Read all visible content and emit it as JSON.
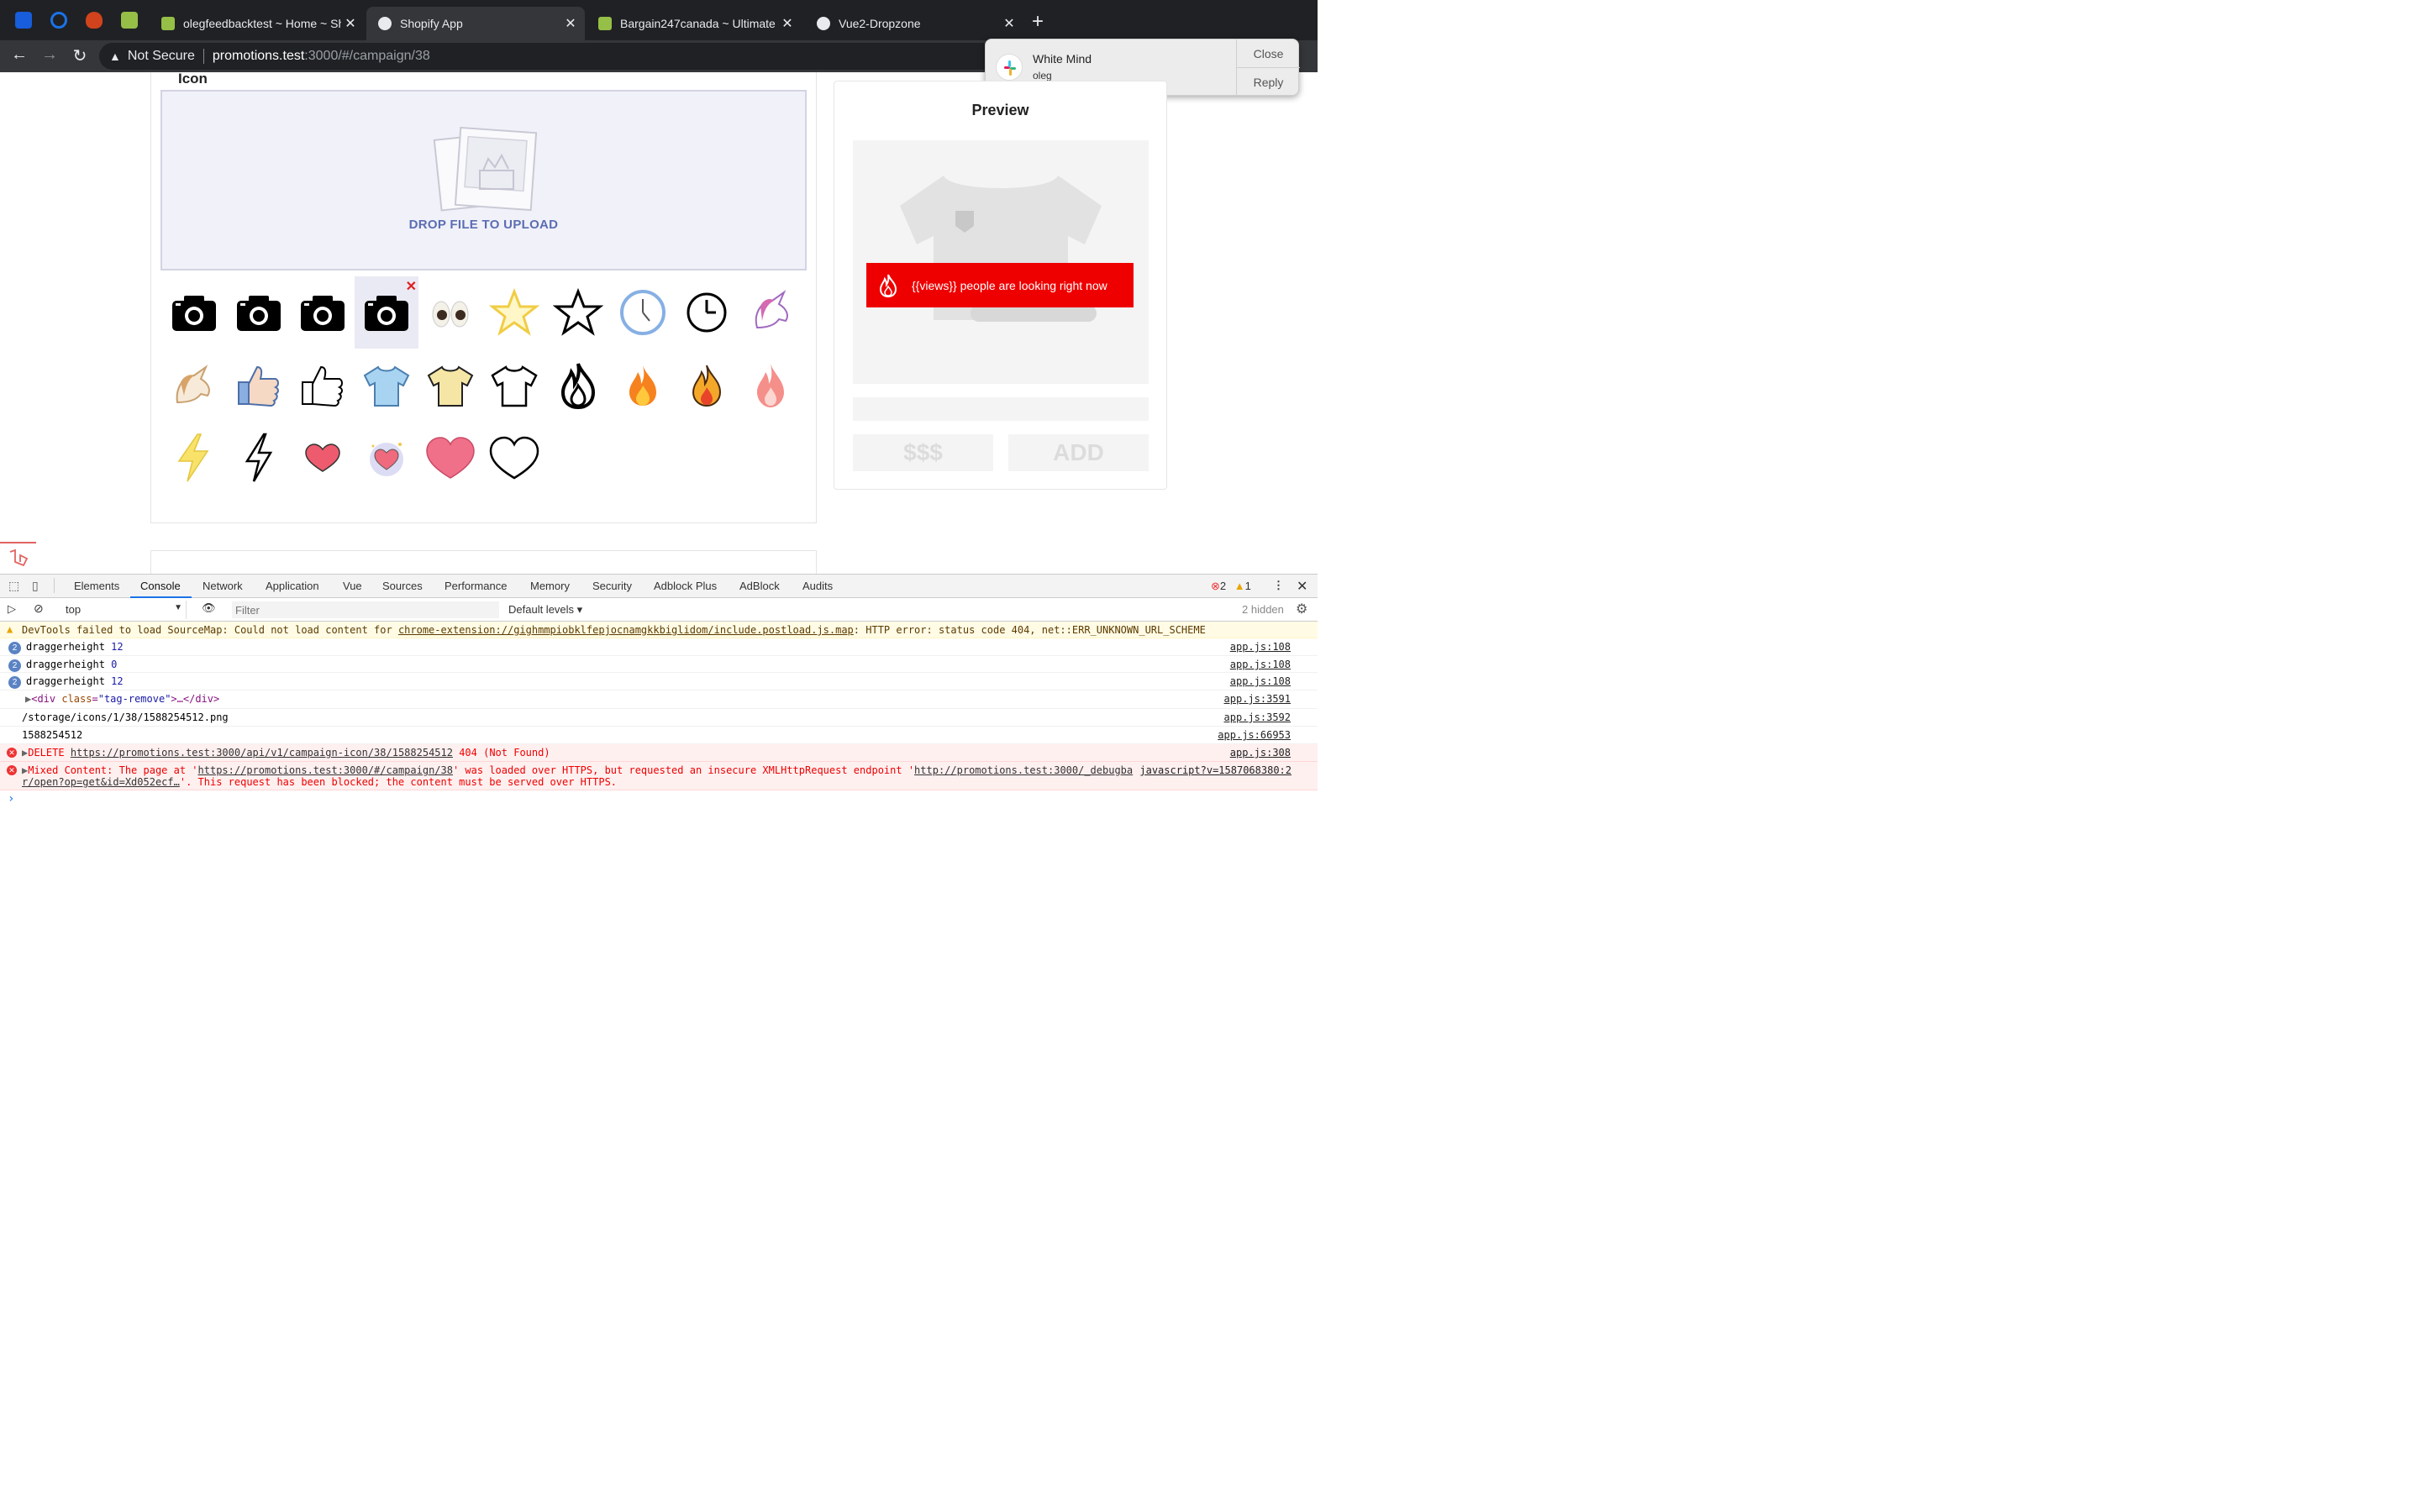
{
  "browser": {
    "tabs": [
      {
        "title": "olegfeedbacktest ~ Home ~ Sh",
        "active": false
      },
      {
        "title": "Shopify App",
        "active": true
      },
      {
        "title": "Bargain247canada ~ Ultimate S",
        "active": false
      },
      {
        "title": "Vue2-Dropzone",
        "active": false
      }
    ],
    "security": "Not Secure",
    "url_host": "promotions.test",
    "url_path": ":3000/#/campaign/38"
  },
  "notification": {
    "app": "Slack",
    "title": "White Mind",
    "subtitle": "oleg",
    "close_label": "Close",
    "reply_label": "Reply"
  },
  "page": {
    "icon_heading": "Icon",
    "dropzone_text": "DROP FILE TO UPLOAD",
    "icons": [
      "camera-icon",
      "camera-icon",
      "camera-icon",
      "camera-icon",
      "eyes-icon",
      "star-outline-yellow-icon",
      "star-outline-black-icon",
      "clock-blue-icon",
      "clock-black-icon",
      "unicorn-icon",
      "unicorn-brown-icon",
      "thumbs-up-color-icon",
      "thumbs-up-outline-icon",
      "tshirt-blue-icon",
      "tshirt-yellow-icon",
      "tshirt-outline-icon",
      "fire-outline-icon",
      "fire-emoji-icon",
      "fire-orange-icon",
      "fire-pink-icon",
      "lightning-yellow-icon",
      "lightning-outline-icon",
      "heart-small-icon",
      "heart-badge-icon",
      "heart-large-icon",
      "heart-outline-icon"
    ],
    "selected_icon_index": 3,
    "preview": {
      "heading": "Preview",
      "badge_text": "{{views}} people are looking right now",
      "badge_color": "#ef0000",
      "price_label": "$$$",
      "add_label": "ADD"
    }
  },
  "devtools": {
    "tabs": [
      "Elements",
      "Console",
      "Network",
      "Application",
      "Vue",
      "Sources",
      "Performance",
      "Memory",
      "Security",
      "Adblock Plus",
      "AdBlock",
      "Audits"
    ],
    "active_tab": "Console",
    "error_count": "2",
    "warning_count": "1",
    "context": "top",
    "filter_placeholder": "Filter",
    "levels": "Default levels ▾",
    "hidden": "2 hidden",
    "messages": {
      "warn": {
        "prefix": "DevTools failed to load SourceMap: Could not load content for ",
        "link": "chrome-extension://gighmmpiobklfepjocnamgkkbiglidom/include.postload.js.map",
        "suffix": ": HTTP error: status code 404, net::ERR_UNKNOWN_URL_SCHEME"
      },
      "log1": {
        "count": "2",
        "label": "draggerheight",
        "value": "12",
        "src": "app.js:108"
      },
      "log2": {
        "count": "2",
        "label": "draggerheight",
        "value": "0",
        "src": "app.js:108"
      },
      "log3": {
        "count": "2",
        "label": "draggerheight",
        "value": "12",
        "src": "app.js:108"
      },
      "log4": {
        "tag_open": "<div ",
        "attr": "class",
        "value": "\"tag-remove\"",
        "rest": ">…</div>",
        "src": "app.js:3591"
      },
      "log5": {
        "text": "/storage/icons/1/38/1588254512.png",
        "src": "app.js:3592"
      },
      "log6": {
        "text": "1588254512",
        "src": "app.js:66953"
      },
      "err1": {
        "method": "DELETE ",
        "url": "https://promotions.test:3000/api/v1/campaign-icon/38/1588254512",
        "status": " 404 (Not Found)",
        "src": "app.js:308"
      },
      "err2": {
        "line1_a": "Mixed Content: The page at '",
        "line1_url": "https://promotions.test:3000/#/campaign/38",
        "line1_b": "' was loaded over HTTPS, but requested an insecure XMLHttpRequest endpoint '",
        "line1_url2": "http://promotions.test:3000/_debugba",
        "line1_src": "javascript?v=1587068380:2",
        "line2_url": "r/open?op=get&id=Xd052ecf…",
        "line2_b": "'. This request has been blocked; the content must be served over HTTPS."
      }
    }
  }
}
